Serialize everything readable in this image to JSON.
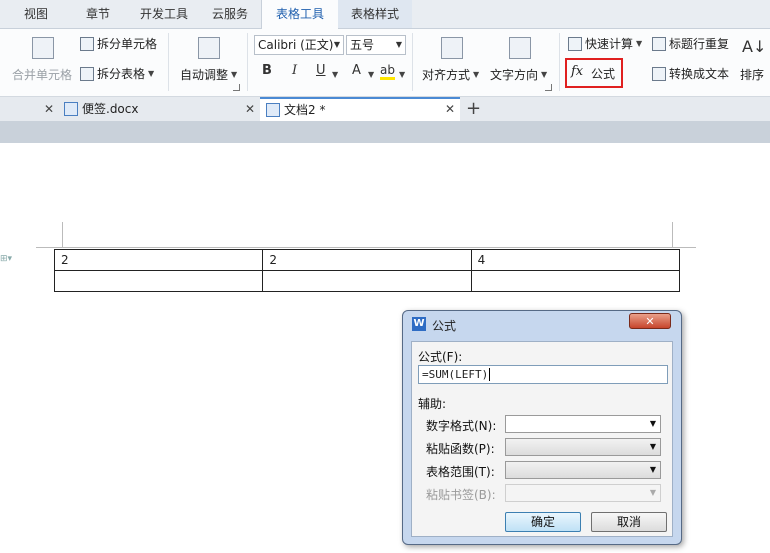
{
  "menu": {
    "tabs": [
      "视图",
      "章节",
      "开发工具",
      "云服务",
      "表格工具",
      "表格样式"
    ],
    "active": "表格工具"
  },
  "ribbon": {
    "merge_cells": "合并单元格",
    "split_cells": "拆分单元格",
    "split_table": "拆分表格",
    "autofit": "自动调整",
    "font_name": "Calibri (正文)",
    "font_size": "五号",
    "bold": "B",
    "italic": "I",
    "underline": "U",
    "font_color": "A",
    "highlight": "ab",
    "align": "对齐方式",
    "text_direction": "文字方向",
    "quick_calc": "快速计算",
    "formula_fx": "fx",
    "formula": "公式",
    "repeat_header": "标题行重复",
    "convert_text": "转换成文本",
    "sort": "排序"
  },
  "doc_tabs": [
    {
      "name": "便签.docx",
      "active": false
    },
    {
      "name": "文档2 *",
      "active": true
    }
  ],
  "table": {
    "rows": [
      [
        "2",
        "2",
        "4"
      ],
      [
        "",
        "",
        ""
      ]
    ]
  },
  "dialog": {
    "title": "公式",
    "formula_label": "公式(F):",
    "formula_value": "=SUM(LEFT)",
    "assist_label": "辅助:",
    "number_format_label": "数字格式(N):",
    "paste_function_label": "粘贴函数(P):",
    "table_range_label": "表格范围(T):",
    "paste_bookmark_label": "粘贴书签(B):",
    "ok": "确定",
    "cancel": "取消"
  },
  "colors": {
    "accent_blue": "#1f5fae",
    "highlight_red": "#e02020",
    "dialog_frame": "#c6d7ee"
  }
}
